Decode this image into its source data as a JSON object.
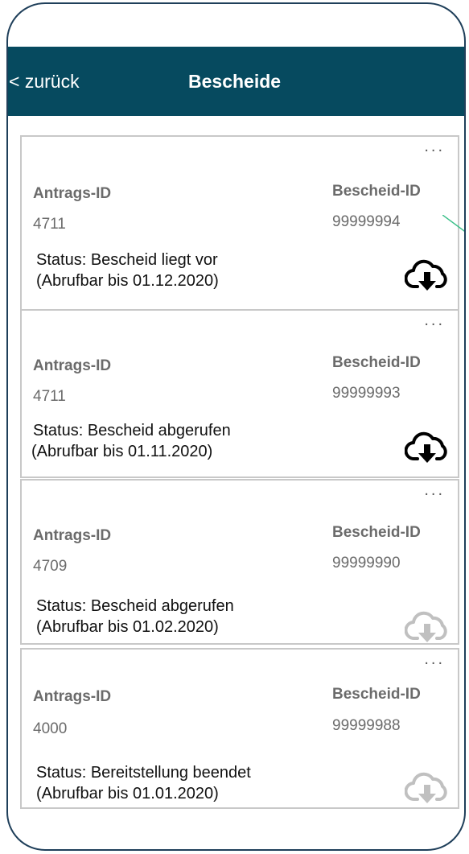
{
  "header": {
    "back_label": "< zurück",
    "title": "Bescheide"
  },
  "labels": {
    "antrags_id": "Antrags-ID",
    "bescheid_id": "Bescheid-ID",
    "more": "..."
  },
  "cards": [
    {
      "antrags_id": "4711",
      "bescheid_id": "99999994",
      "status": "Status: Bescheid liegt vor",
      "abrufbar": "(Abrufbar bis 01.12.2020)",
      "download_enabled": true
    },
    {
      "antrags_id": "4711",
      "bescheid_id": "99999993",
      "status": "Status: Bescheid abgerufen",
      "abrufbar": "(Abrufbar bis 01.11.2020)",
      "download_enabled": true
    },
    {
      "antrags_id": "4709",
      "bescheid_id": "99999990",
      "status": "Status: Bescheid abgerufen",
      "abrufbar": "(Abrufbar bis 01.02.2020)",
      "download_enabled": false
    },
    {
      "antrags_id": "4000",
      "bescheid_id": "99999988",
      "status": "Status: Bereitstellung beendet",
      "abrufbar": "(Abrufbar bis 01.01.2020)",
      "download_enabled": false
    }
  ],
  "colors": {
    "header_bg": "#064a5f",
    "frame_border": "#1f3f5a",
    "card_border": "#c8c8c8",
    "muted_text": "#6b6b6b",
    "icon_enabled": "#000000",
    "icon_disabled": "#c0c0c0"
  },
  "icons": {
    "download": "cloud-download-icon",
    "more": "more-dots-icon"
  }
}
